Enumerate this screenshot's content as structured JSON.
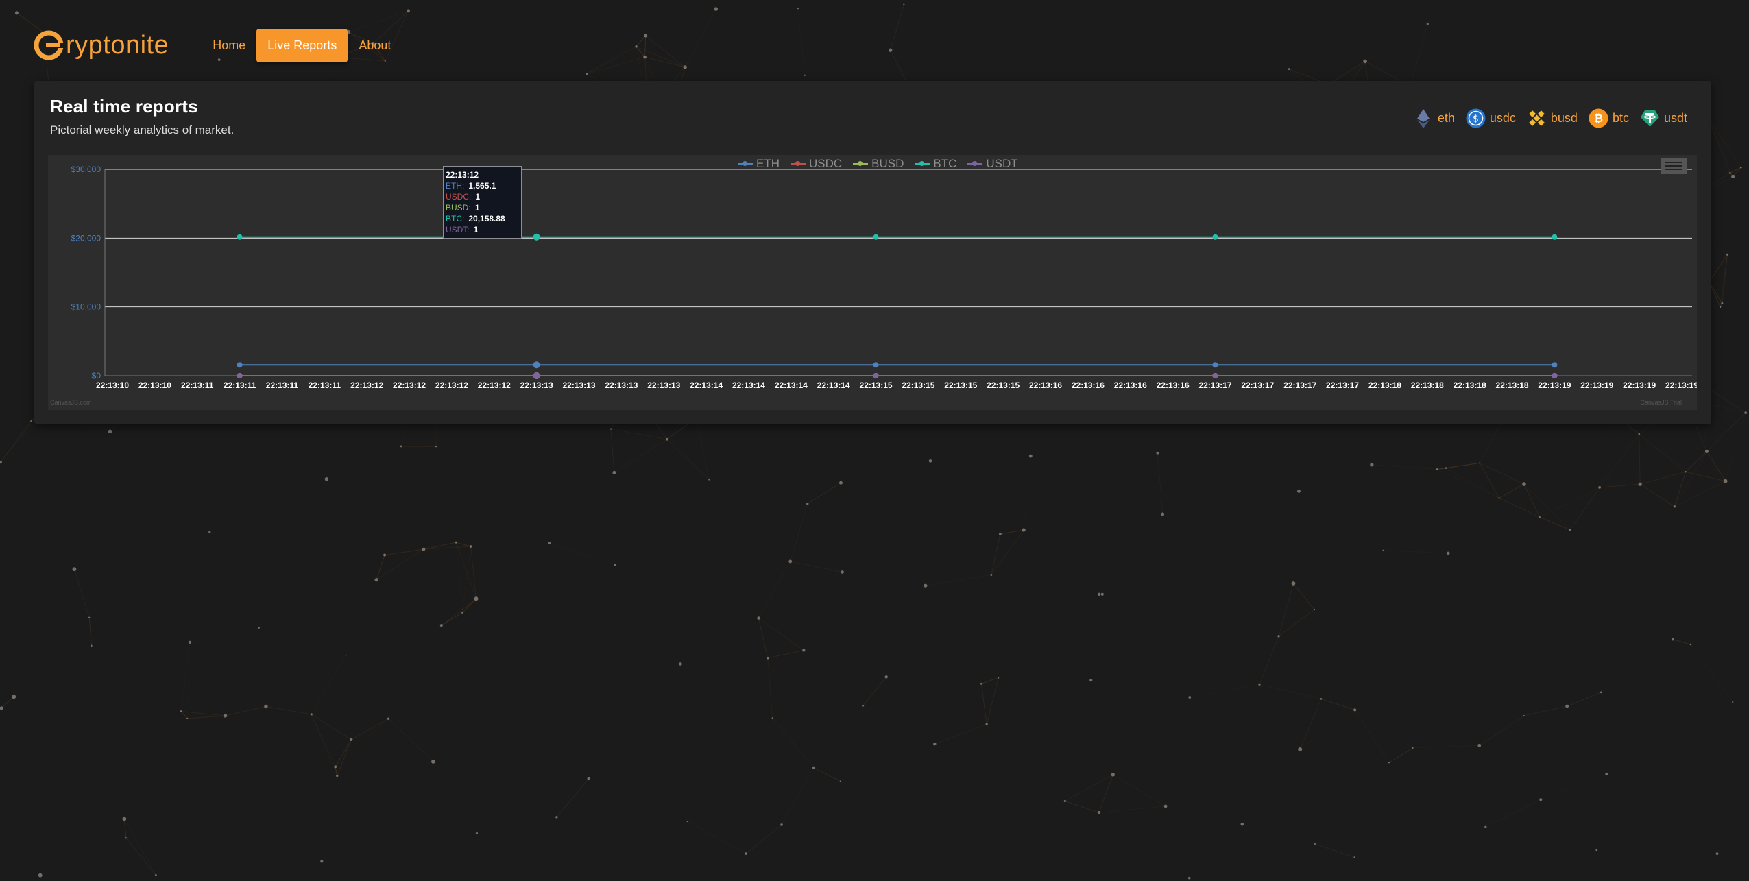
{
  "brand": {
    "name": "ryptonite",
    "color": "#f7a33b"
  },
  "nav": {
    "items": [
      {
        "label": "Home",
        "active": false
      },
      {
        "label": "Live Reports",
        "active": true
      },
      {
        "label": "About",
        "active": false
      }
    ]
  },
  "panel": {
    "title": "Real time reports",
    "subtitle": "Pictorial weekly analytics of market."
  },
  "coin_tabs": [
    {
      "label": "eth",
      "icon": "ethereum-icon"
    },
    {
      "label": "usdc",
      "icon": "usdc-icon"
    },
    {
      "label": "busd",
      "icon": "binance-icon"
    },
    {
      "label": "btc",
      "icon": "bitcoin-icon"
    },
    {
      "label": "usdt",
      "icon": "tether-icon"
    }
  ],
  "tooltip": {
    "time": "22:13:12",
    "rows": [
      {
        "label": "ETH:",
        "value": "1,565.1",
        "color": "#4f81bc"
      },
      {
        "label": "USDC:",
        "value": "1",
        "color": "#c0504e"
      },
      {
        "label": "BUSD:",
        "value": "1",
        "color": "#9bbb58"
      },
      {
        "label": "BTC:",
        "value": "20,158.88",
        "color": "#23bfaa"
      },
      {
        "label": "USDT:",
        "value": "1",
        "color": "#8064a1"
      }
    ]
  },
  "credits": {
    "left": "CanvasJS.com",
    "right": "CanvasJS Trial"
  },
  "chart_data": {
    "type": "line",
    "title": "",
    "xlabel": "",
    "ylabel": "",
    "ylim": [
      0,
      30000
    ],
    "y_ticks": [
      "$0",
      "$10,000",
      "$20,000",
      "$30,000"
    ],
    "y_tick_values": [
      0,
      10000,
      20000,
      30000
    ],
    "x_tick_labels": [
      "22:13:10",
      "22:13:10",
      "22:13:11",
      "22:13:11",
      "22:13:11",
      "22:13:11",
      "22:13:12",
      "22:13:12",
      "22:13:12",
      "22:13:12",
      "22:13:13",
      "22:13:13",
      "22:13:13",
      "22:13:13",
      "22:13:14",
      "22:13:14",
      "22:13:14",
      "22:13:14",
      "22:13:15",
      "22:13:15",
      "22:13:15",
      "22:13:15",
      "22:13:16",
      "22:13:16",
      "22:13:16",
      "22:13:16",
      "22:13:17",
      "22:13:17",
      "22:13:17",
      "22:13:17",
      "22:13:18",
      "22:13:18",
      "22:13:18",
      "22:13:18",
      "22:13:19",
      "22:13:19",
      "22:13:19",
      "22:13:19"
    ],
    "x": [
      "22:13:11",
      "22:13:13",
      "22:13:15",
      "22:13:17",
      "22:13:19"
    ],
    "grid": true,
    "legend_position": "top-center",
    "series": [
      {
        "name": "ETH",
        "color": "#4f81bc",
        "values": [
          1565.1,
          1565.1,
          1565.1,
          1565.1,
          1565.1
        ]
      },
      {
        "name": "USDC",
        "color": "#c0504e",
        "values": [
          1,
          1,
          1,
          1,
          1
        ]
      },
      {
        "name": "BUSD",
        "color": "#9bbb58",
        "values": [
          1,
          1,
          1,
          1,
          1
        ]
      },
      {
        "name": "BTC",
        "color": "#23bfaa",
        "values": [
          20158.88,
          20158.88,
          20158.88,
          20158.88,
          20158.88
        ]
      },
      {
        "name": "USDT",
        "color": "#8064a1",
        "values": [
          1,
          1,
          1,
          1,
          1
        ]
      }
    ]
  }
}
